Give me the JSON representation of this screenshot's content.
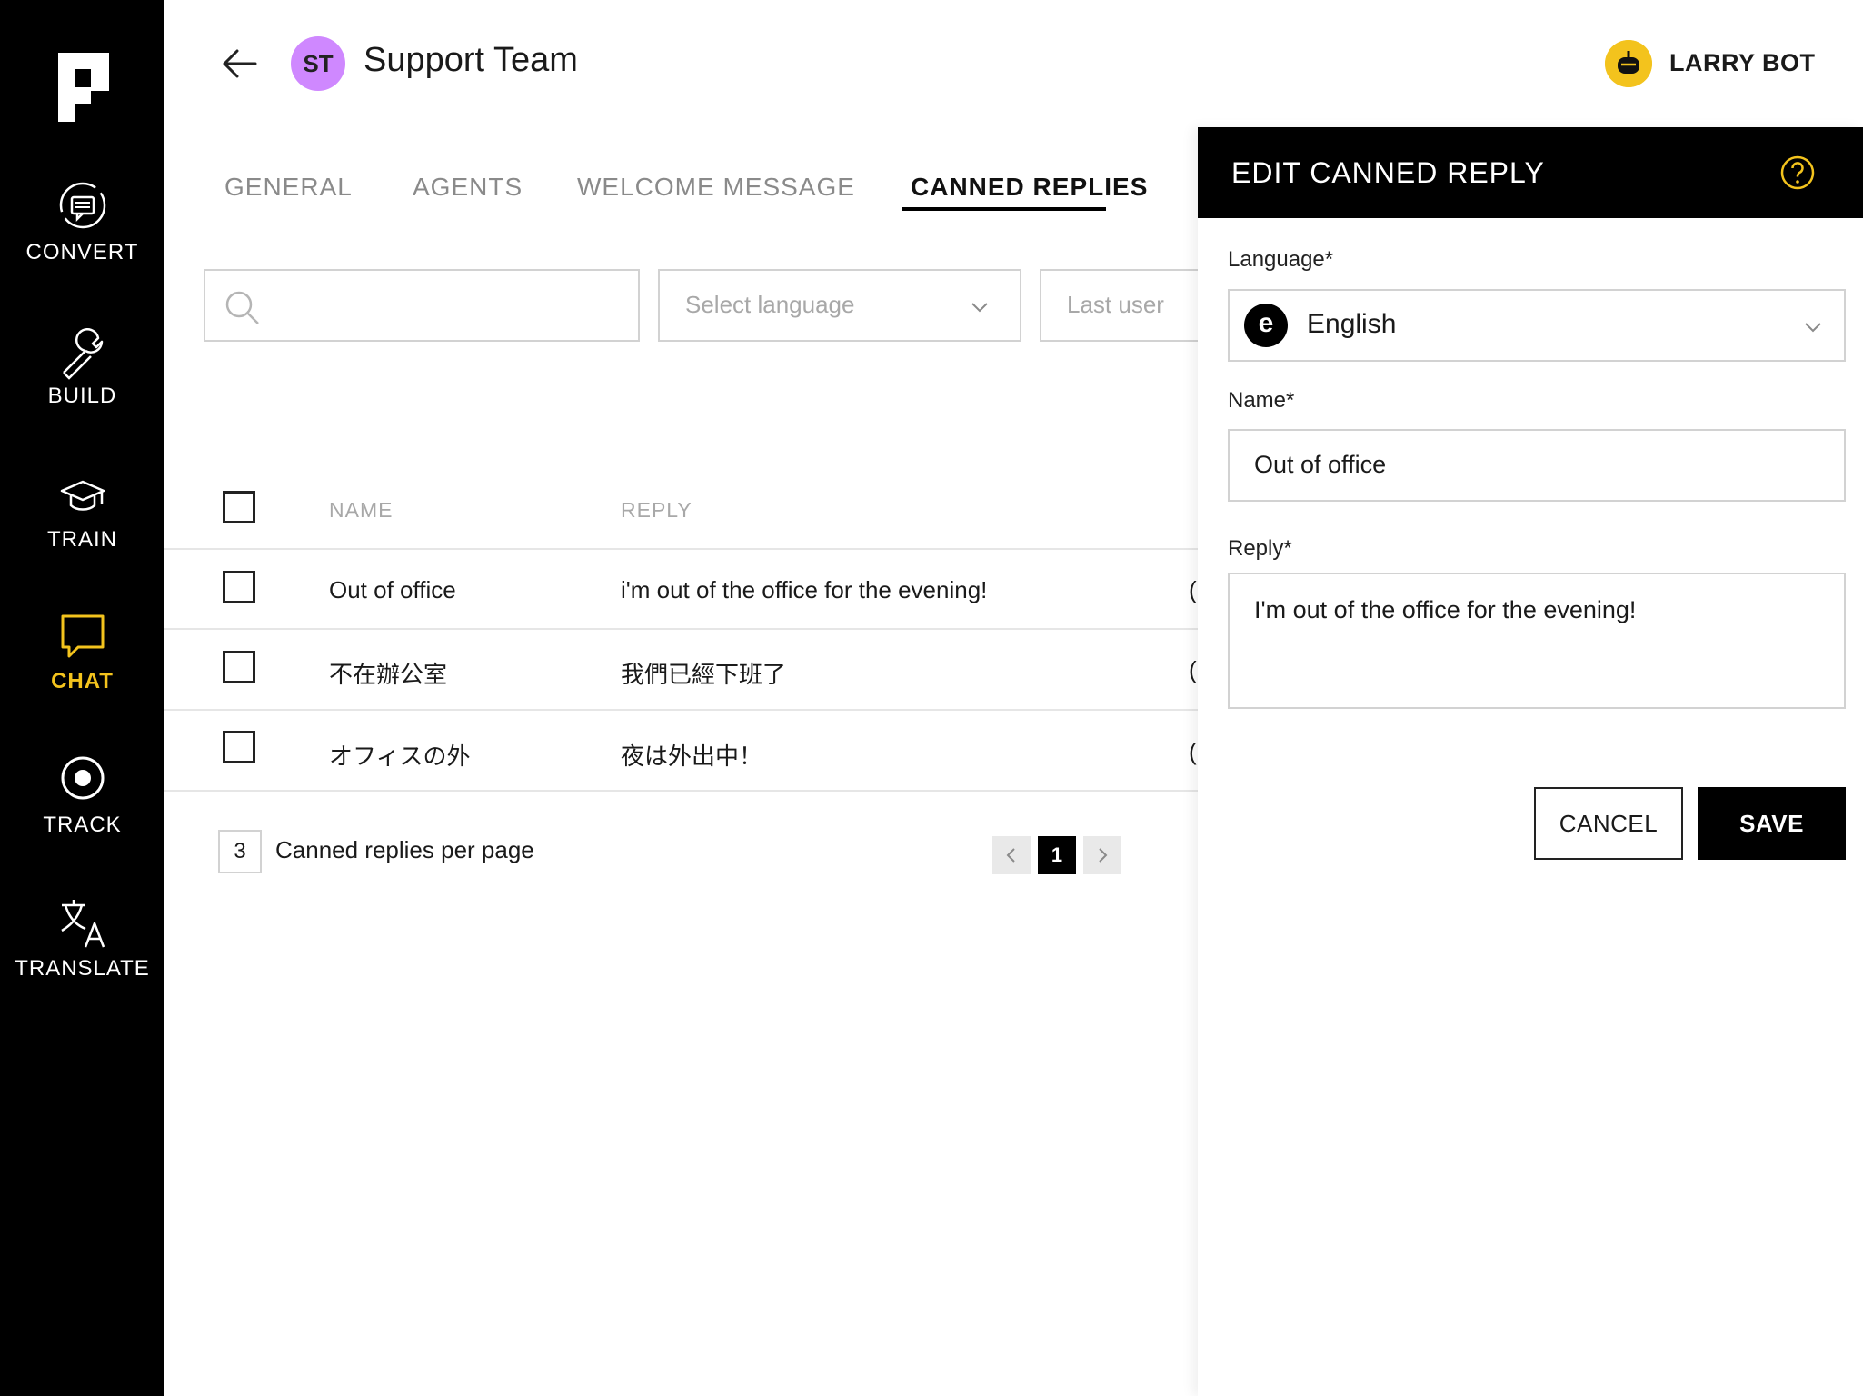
{
  "sidebar": {
    "logo_icon": "brand-logo-icon",
    "active_color": "#f3c31d",
    "items": [
      {
        "label": "CONVERT",
        "icon": "convert-icon"
      },
      {
        "label": "BUILD",
        "icon": "wrench-icon"
      },
      {
        "label": "TRAIN",
        "icon": "graduation-cap-icon"
      },
      {
        "label": "CHAT",
        "icon": "chat-bubble-icon",
        "active": true
      },
      {
        "label": "TRACK",
        "icon": "target-icon"
      },
      {
        "label": "TRANSLATE",
        "icon": "translate-icon"
      }
    ]
  },
  "header": {
    "back_icon": "arrow-left-icon",
    "team_initials": "ST",
    "team_avatar_color": "#cf88ff",
    "team_name": "Support Team",
    "bot_icon": "bot-icon",
    "bot_name": "LARRY BOT"
  },
  "tabs": [
    {
      "label": "GENERAL"
    },
    {
      "label": "AGENTS"
    },
    {
      "label": "WELCOME MESSAGE"
    },
    {
      "label": "CANNED REPLIES",
      "active": true
    }
  ],
  "filters": {
    "search_placeholder": "",
    "language_placeholder": "Select language",
    "last_user_placeholder": "Last user"
  },
  "table": {
    "columns": [
      "NAME",
      "REPLY"
    ],
    "rows": [
      {
        "name": "Out of office",
        "reply": "i'm out of the office for the evening!",
        "edge": "("
      },
      {
        "name": "不在辦公室",
        "reply": "我們已經下班了",
        "edge": "("
      },
      {
        "name": "オフィスの外",
        "reply": "夜は外出中！",
        "edge": "("
      }
    ]
  },
  "pagination": {
    "per_page": "3",
    "per_page_label": "Canned replies per page",
    "current_page": "1"
  },
  "panel": {
    "title": "EDIT CANNED REPLY",
    "help_icon": "help-circle-icon",
    "language_label": "Language*",
    "language_badge": "e",
    "language_value": "English",
    "name_label": "Name*",
    "name_value": "Out of office",
    "reply_label": "Reply*",
    "reply_value": "I'm out of the office for the evening!",
    "cancel_label": "CANCEL",
    "save_label": "SAVE"
  }
}
